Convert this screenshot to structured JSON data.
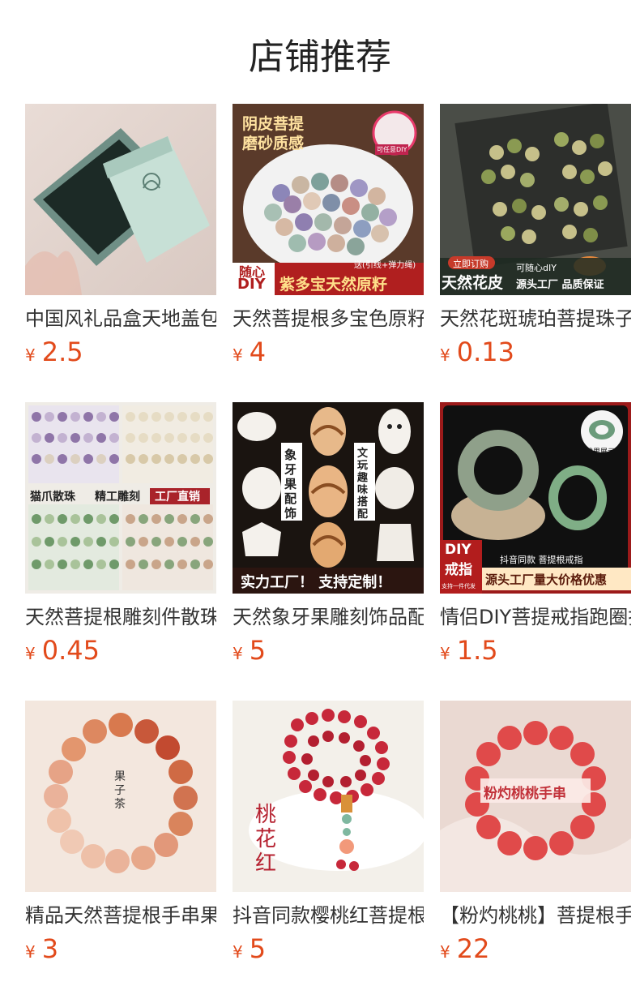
{
  "page": {
    "title": "店铺推荐"
  },
  "currency": "¥",
  "colors": {
    "price": "#e24a1b",
    "text": "#333333"
  },
  "products": [
    {
      "name": "中国风礼品盒天地盖包装盒",
      "price": "2.5",
      "image": {
        "texts": []
      }
    },
    {
      "name": "天然菩提根多宝色原籽散珠",
      "price": "4",
      "image": {
        "texts": [
          "阴皮菩提",
          "磨砂质感",
          "可任意DIY",
          "随心",
          "DIY",
          "紫多宝天然原籽",
          "送(引线+弹力绳)"
        ]
      }
    },
    {
      "name": "天然花斑琥珀菩提珠子散珠",
      "price": "0.13",
      "image": {
        "texts": [
          "立即订购",
          "天然花皮",
          "可随心dIY",
          "源头工厂  品质保证"
        ]
      }
    },
    {
      "name": "天然菩提根雕刻件散珠配件",
      "price": "0.45",
      "image": {
        "texts": [
          "猫爪散珠",
          "精工雕刻",
          "工厂直销"
        ]
      }
    },
    {
      "name": "天然象牙果雕刻饰品配件",
      "price": "5",
      "image": {
        "texts": [
          "象牙果配饰",
          "文玩趣味搭配",
          "实力工厂！ 支持定制！"
        ]
      }
    },
    {
      "name": "情侣DIY菩提戒指跑圈指环",
      "price": "1.5",
      "image": {
        "texts": [
          "成果展示",
          "DIY",
          "戒指",
          "抖音同款 菩提根戒指",
          "源头工厂量大价格优惠",
          "支持一件代发"
        ]
      }
    },
    {
      "name": "精品天然菩提根手串果子茶",
      "price": "3",
      "image": {
        "texts": [
          "果子茶"
        ]
      }
    },
    {
      "name": "抖音同款樱桃红菩提根手串",
      "price": "5",
      "image": {
        "texts": [
          "桃花红"
        ]
      }
    },
    {
      "name": "【粉灼桃桃】菩提根手串",
      "price": "22",
      "image": {
        "texts": [
          "粉灼桃桃手串"
        ]
      }
    }
  ]
}
